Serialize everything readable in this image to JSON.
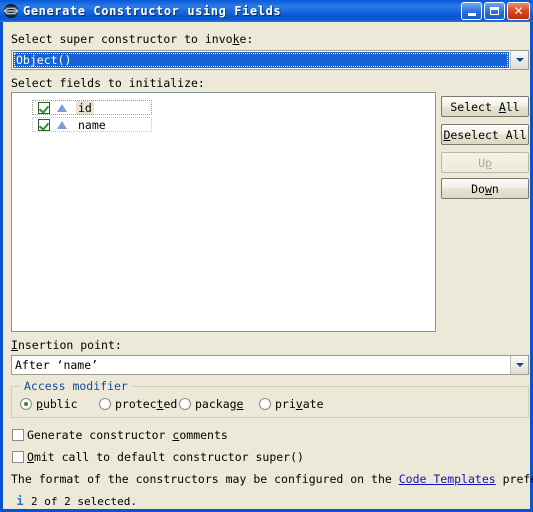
{
  "window": {
    "title": "Generate Constructor using Fields",
    "icon": "globe-icon",
    "accent_color": "#0A53CE",
    "background_color": "#ECE9D8",
    "buttons": {
      "minimize": "minimize-icon",
      "maximize": "maximize-icon",
      "close": "close-icon"
    }
  },
  "super_constructor": {
    "label_before": "Select super constructor to invo",
    "label_mnemonic": "k",
    "label_after": "e:",
    "value": "Object()",
    "selected": true
  },
  "fields_section": {
    "label": "Select fields to initialize:",
    "rows": [
      {
        "name": "id",
        "checked": true,
        "icon": "java-field-icon",
        "focused": true,
        "highlighted": true
      },
      {
        "name": "name",
        "checked": true,
        "icon": "java-field-icon",
        "focused": false,
        "highlighted": false
      }
    ]
  },
  "side_buttons": [
    {
      "name": "select-all",
      "before": "Select ",
      "mnemonic": "A",
      "after": "ll",
      "enabled": true
    },
    {
      "name": "deselect-all",
      "before": "",
      "mnemonic": "D",
      "after": "eselect All",
      "enabled": true
    },
    {
      "name": "up",
      "before": "U",
      "mnemonic": "p",
      "after": "",
      "enabled": false
    },
    {
      "name": "down",
      "before": "Do",
      "mnemonic": "w",
      "after": "n",
      "enabled": true
    }
  ],
  "insertion_point": {
    "label_mnemonic": "I",
    "label_after": "nsertion point:",
    "value": "After ‘name’"
  },
  "access_modifier": {
    "group_title": "Access modifier",
    "group_title_color": "#19499C",
    "options": [
      {
        "before": "",
        "mnemonic": "p",
        "after": "ublic",
        "selected": true
      },
      {
        "before": "protec",
        "mnemonic": "t",
        "after": "ed",
        "selected": false
      },
      {
        "before": "packag",
        "mnemonic": "e",
        "after": "",
        "selected": false
      },
      {
        "before": "pri",
        "mnemonic": "v",
        "after": "ate",
        "selected": false
      }
    ]
  },
  "options": [
    {
      "before": "Generate constructor ",
      "mnemonic": "c",
      "after": "omments",
      "checked": false
    },
    {
      "before": "",
      "mnemonic": "O",
      "after": "mit call to default constructor super()",
      "checked": false
    }
  ],
  "footer": {
    "note_before": "The format of the constructors may be configured on the ",
    "link_text": "Code Templates",
    "note_after": " preference page.",
    "link_color": "#1515B0",
    "status_icon": "info-icon",
    "status_text": "2 of 2 selected."
  }
}
